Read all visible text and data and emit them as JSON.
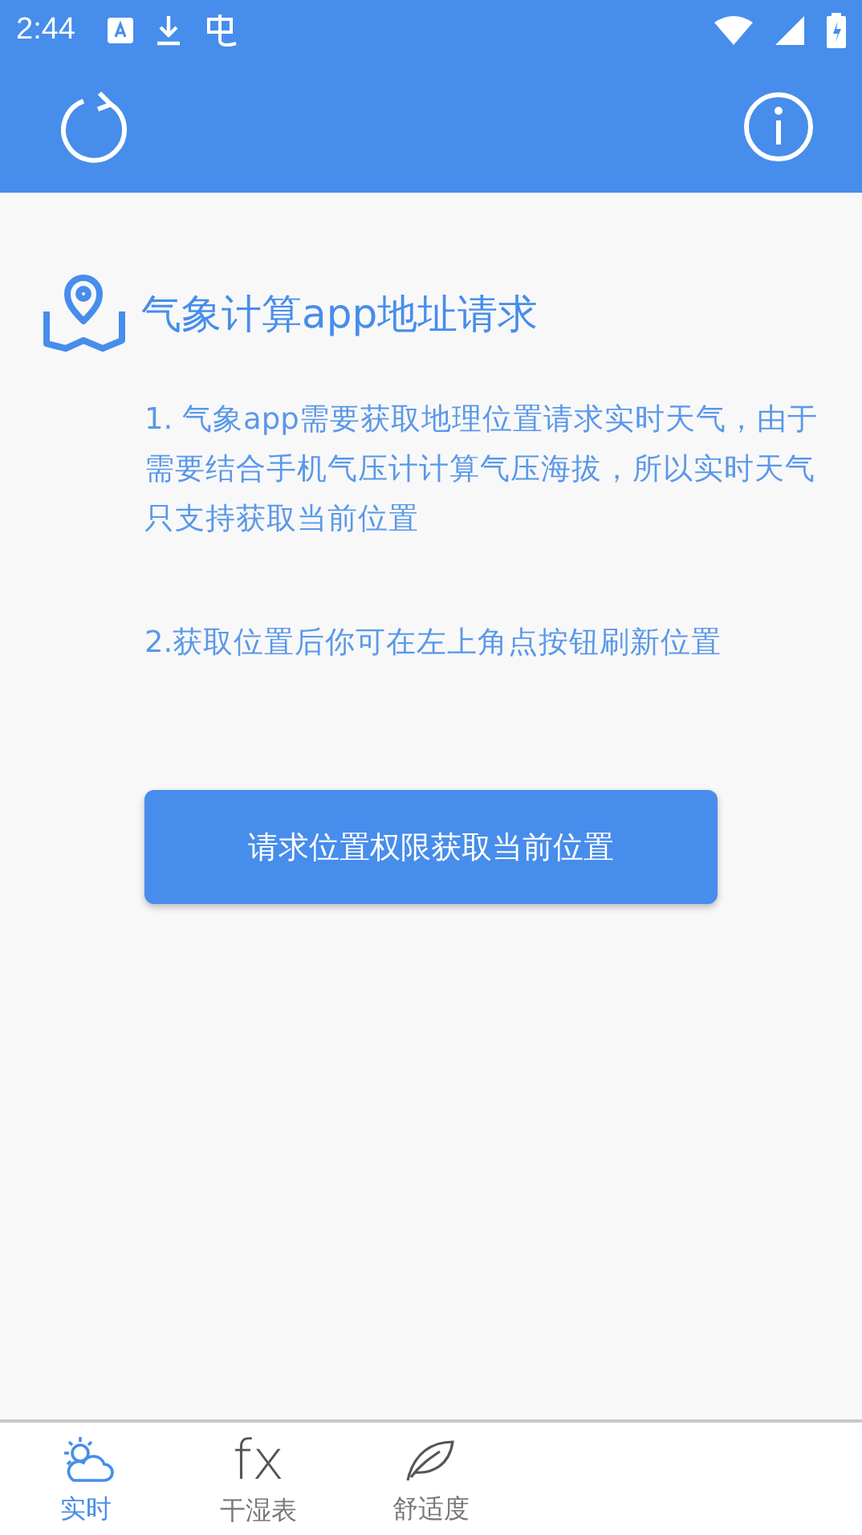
{
  "status_bar": {
    "time": "2:44"
  },
  "header": {
    "title": "气象计算app地址请求"
  },
  "notes": [
    "1. 气象app需要获取地理位置请求实时天气，由于需要结合手机气压计计算气压海拔，所以实时天气只支持获取当前位置",
    "2.获取位置后你可在左上角点按钮刷新位置"
  ],
  "action_button": {
    "label": "请求位置权限获取当前位置"
  },
  "bottom_nav": [
    {
      "kind": "weather",
      "label": "实时",
      "selected": true
    },
    {
      "kind": "glyph",
      "glyph": "fx",
      "label": "干湿表",
      "selected": false
    },
    {
      "kind": "leaf",
      "label": "舒适度",
      "selected": false
    }
  ]
}
